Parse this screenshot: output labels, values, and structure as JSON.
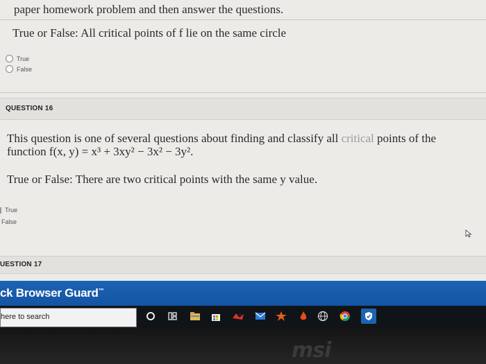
{
  "prev_question": {
    "instruction_fragment": "paper homework problem and then answer the questions.",
    "prompt": "True or False: All critical points of f lie on the same circle",
    "options": [
      "True",
      "False"
    ]
  },
  "question16": {
    "header": "QUESTION 16",
    "text_line1_a": "This question is one of several questions about finding and classify all ",
    "text_line1_b": "critical",
    "text_line1_c": " points of the",
    "text_line2": "function f(x, y) = x³ + 3xy² − 3x² − 3y².",
    "prompt": "True or False: There are two critical points with the same y value.",
    "options": [
      "True",
      "False"
    ]
  },
  "question17": {
    "header": "UESTION 17"
  },
  "banner": {
    "text": "ck Browser Guard",
    "tm": "™"
  },
  "taskbar": {
    "search_placeholder": "here to search",
    "icons": [
      "cortana-icon",
      "task-view-icon",
      "file-explorer-icon",
      "store-icon",
      "app-icon",
      "mail-icon",
      "game-icon",
      "globe-icon",
      "chrome-icon",
      "shield-icon"
    ]
  },
  "bezel": {
    "logo": "msi"
  }
}
